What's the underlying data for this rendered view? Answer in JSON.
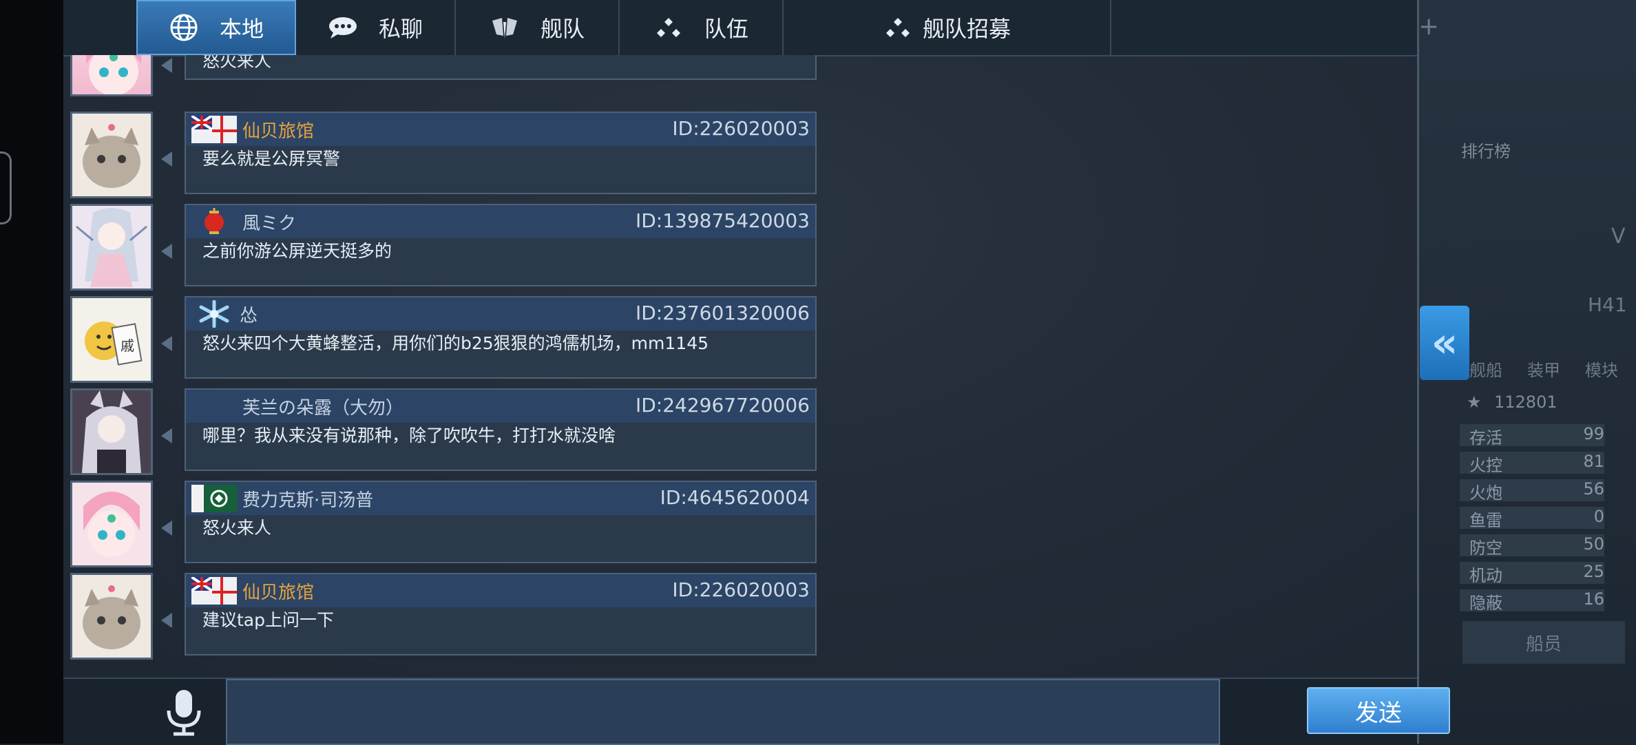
{
  "tabs": [
    {
      "label": "本地",
      "icon": "globe-icon",
      "active": true
    },
    {
      "label": "私聊",
      "icon": "chat-bubble-icon",
      "active": false
    },
    {
      "label": "舰队",
      "icon": "fleet-wings-icon",
      "active": false
    },
    {
      "label": "队伍",
      "icon": "team-dots-icon",
      "active": false
    },
    {
      "label": "舰队招募",
      "icon": "team-dots-icon",
      "active": false
    }
  ],
  "messages": [
    {
      "name": "",
      "id": "",
      "text": "怒火来人",
      "avatar": "pink-hair-girl-avatar"
    },
    {
      "name": "仙贝旅馆",
      "name_color": "orange",
      "id": "ID:226020003",
      "text": "要么就是公屏冥警",
      "badge": "uk-naval-flag",
      "avatar": "cat-avatar"
    },
    {
      "name": "風ミク",
      "id": "ID:139875420003",
      "text": "之前你游公屏逆天挺多的",
      "badge": "lantern",
      "avatar": "miku-avatar"
    },
    {
      "name": "怂",
      "id": "ID:237601320006",
      "text": "怒火来四个大黄蜂整活，用你们的b25狠狠的鸿儒机场，mm1145",
      "badge": "snowflake",
      "avatar": "emoji-sticker-avatar"
    },
    {
      "name": "芙兰の朵露（大勿）",
      "id": "ID:242967720006",
      "text": "哪里？我从来没有说那种，除了吹吹牛，打打水就没啥",
      "badge": "",
      "avatar": "silver-hair-girl-avatar"
    },
    {
      "name": "费力克斯·司汤普",
      "id": "ID:4645620004",
      "text": "怒火来人",
      "badge": "green-flag",
      "avatar": "pink-hair-girl-avatar"
    },
    {
      "name": "仙贝旅馆",
      "name_color": "orange",
      "id": "ID:226020003",
      "text": "建议tap上问一下",
      "badge": "uk-naval-flag",
      "avatar": "cat-avatar"
    }
  ],
  "input": {
    "value": "",
    "placeholder": ""
  },
  "send_label": "发送",
  "right_panel": {
    "ranking_label": "排行榜",
    "ship_code": "H41",
    "level_letter": "V",
    "tabs": [
      "舰船",
      "装甲",
      "模块"
    ],
    "score": "112801",
    "stats": [
      {
        "name": "存活",
        "value": "99"
      },
      {
        "name": "火控",
        "value": "81"
      },
      {
        "name": "火炮",
        "value": "56"
      },
      {
        "name": "鱼雷",
        "value": "0"
      },
      {
        "name": "防空",
        "value": "50"
      },
      {
        "name": "机动",
        "value": "25"
      },
      {
        "name": "隐蔽",
        "value": "16"
      }
    ],
    "crew_label": "船员",
    "plus_label": "+"
  },
  "colors": {
    "accent": "#2f7fcf",
    "orange_name": "#e8a33c",
    "bubble_head": "#2c4566"
  }
}
